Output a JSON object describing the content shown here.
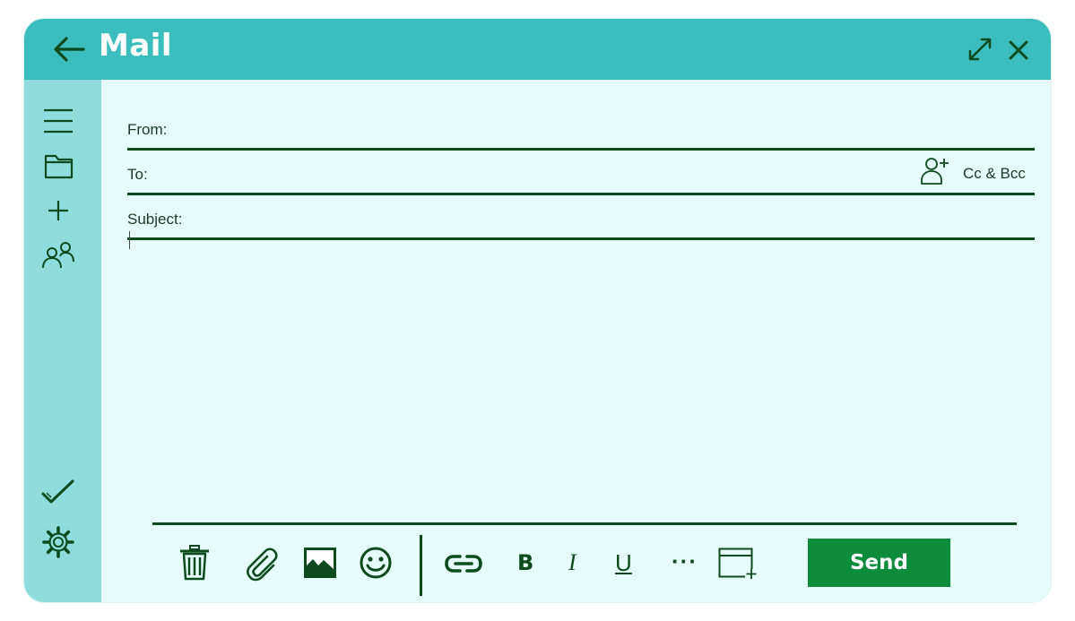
{
  "window": {
    "title": "Mail"
  },
  "titlebar": {
    "back_icon": "arrow-left-icon",
    "expand_icon": "expand-icon",
    "close_icon": "close-icon"
  },
  "sidebar": {
    "top_items": [
      {
        "icon": "menu-icon"
      },
      {
        "icon": "folder-icon"
      },
      {
        "icon": "plus-icon"
      },
      {
        "icon": "contacts-icon"
      }
    ],
    "bottom_items": [
      {
        "icon": "checkmark-icon"
      },
      {
        "icon": "gear-icon"
      }
    ]
  },
  "compose": {
    "from_label": "From:",
    "from_value": "",
    "to_label": "To:",
    "to_value": "",
    "cc_bcc_label": "Cc & Bcc",
    "subject_label": "Subject:",
    "subject_value": "",
    "body_value": ""
  },
  "toolbar": {
    "delete_icon": "trash-icon",
    "attach_icon": "paperclip-icon",
    "image_icon": "image-icon",
    "emoji_icon": "smiley-icon",
    "link_icon": "link-icon",
    "bold_label": "B",
    "italic_label": "I",
    "underline_label": "U",
    "more_label": "···",
    "new_window_icon": "new-window-icon",
    "send_label": "Send"
  },
  "colors": {
    "titlebar": "#3cbdbd",
    "sidebar": "#8fdcdc",
    "canvas": "#e6fcfb",
    "ink": "#0d4a1e",
    "send_button": "#0d8c3c"
  }
}
